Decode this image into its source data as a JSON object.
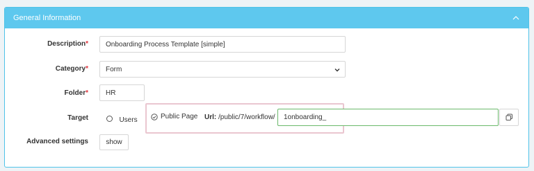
{
  "panel": {
    "title": "General Information",
    "collapse_icon": "chevron-up-icon"
  },
  "fields": {
    "description": {
      "label": "Description",
      "required": "*",
      "value": "Onboarding Process Template [simple]"
    },
    "category": {
      "label": "Category",
      "required": "*",
      "value": "Form"
    },
    "folder": {
      "label": "Folder",
      "required": "*",
      "value": "HR"
    },
    "target": {
      "label": "Target",
      "option_users": "Users",
      "option_public": "Public Page",
      "url_label": "Url:",
      "url_prefix": "/public/7/workflow/",
      "url_value": "1onboarding_"
    },
    "advanced": {
      "label": "Advanced settings",
      "button": "show"
    }
  },
  "icons": {
    "copy": "copy-icon",
    "select_caret": "chevron-down-icon",
    "check_circle": "check-circle-icon"
  },
  "colors": {
    "header": "#5ec8ee",
    "required": "#e0303a",
    "highlight": "#eac6d0",
    "url_focus": "#6ab86a"
  }
}
